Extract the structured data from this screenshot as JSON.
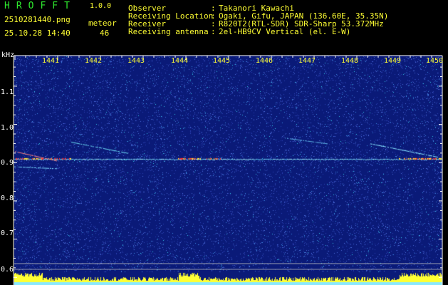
{
  "header": {
    "app_title": "HROFFT",
    "app_version": "1.0.0",
    "filename": "2510281440.png",
    "detection_label": "meteor",
    "datetime": "25.10.28 14:40",
    "count": "46"
  },
  "info": {
    "observer_label": "Observer",
    "observer_value": "Takanori Kawachi",
    "location_label": "Receiving Location",
    "location_value": "Ogaki, Gifu, JAPAN (136.60E, 35.35N)",
    "receiver_label": "Receiver",
    "receiver_value": "R820T2(RTL-SDR) SDR-Sharp 53.372MHz",
    "antenna_label": "Receiving antenna",
    "antenna_value": "2el-HB9CV Vertical (el. E-W)",
    "separator": ":"
  },
  "plot": {
    "unit_label": "kHz",
    "time_ticks": [
      "1441",
      "1442",
      "1443",
      "1444",
      "1445",
      "1446",
      "1447",
      "1448",
      "1449",
      "1450"
    ],
    "freq_ticks": [
      "1.1",
      "1.0",
      "0.9",
      "0.8",
      "0.7",
      "0.6"
    ],
    "colors": {
      "background": "#0a1a78",
      "noise_light": "#4a6ad8",
      "noise_cyan": "#33c8e8",
      "carrier": "#9ef0ff",
      "echo_hot": "#ff3030",
      "baseline": "#ffff33",
      "footer": "#8ae8ff"
    }
  },
  "chart_data": {
    "type": "heatmap",
    "x_ticks": [
      "1441",
      "1442",
      "1443",
      "1444",
      "1445",
      "1446",
      "1447",
      "1448",
      "1449",
      "1450"
    ],
    "y_unit": "kHz",
    "y_ticks": [
      1.1,
      1.0,
      0.9,
      0.8,
      0.7,
      0.6
    ],
    "ylim": [
      0.58,
      1.18
    ],
    "carrier_freq_khz": 0.91
  }
}
